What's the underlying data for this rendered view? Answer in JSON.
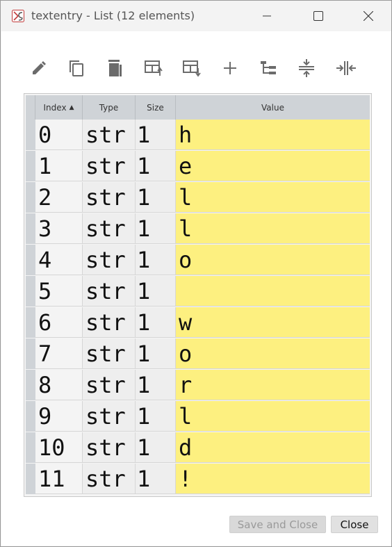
{
  "window": {
    "title": "textentry - List (12 elements)"
  },
  "toolbar": {
    "buttons": [
      {
        "icon": "edit-icon"
      },
      {
        "icon": "copy-icon"
      },
      {
        "icon": "delete-icon"
      },
      {
        "icon": "insert-above-icon"
      },
      {
        "icon": "insert-below-icon"
      },
      {
        "icon": "add-icon"
      },
      {
        "icon": "tree-icon"
      },
      {
        "icon": "collapse-rows-icon"
      },
      {
        "icon": "collapse-columns-icon"
      }
    ]
  },
  "table": {
    "headers": {
      "index": "Index",
      "type": "Type",
      "size": "Size",
      "value": "Value"
    },
    "rows": [
      {
        "index": "0",
        "type": "str",
        "size": "1",
        "value": "h"
      },
      {
        "index": "1",
        "type": "str",
        "size": "1",
        "value": "e"
      },
      {
        "index": "2",
        "type": "str",
        "size": "1",
        "value": "l"
      },
      {
        "index": "3",
        "type": "str",
        "size": "1",
        "value": "l"
      },
      {
        "index": "4",
        "type": "str",
        "size": "1",
        "value": "o"
      },
      {
        "index": "5",
        "type": "str",
        "size": "1",
        "value": ""
      },
      {
        "index": "6",
        "type": "str",
        "size": "1",
        "value": "w"
      },
      {
        "index": "7",
        "type": "str",
        "size": "1",
        "value": "o"
      },
      {
        "index": "8",
        "type": "str",
        "size": "1",
        "value": "r"
      },
      {
        "index": "9",
        "type": "str",
        "size": "1",
        "value": "l"
      },
      {
        "index": "10",
        "type": "str",
        "size": "1",
        "value": "d"
      },
      {
        "index": "11",
        "type": "str",
        "size": "1",
        "value": "!"
      }
    ]
  },
  "footer": {
    "save_close_label": "Save and Close",
    "close_label": "Close"
  },
  "colors": {
    "value_cell": "#fdf080",
    "header": "#cfd3d7"
  }
}
